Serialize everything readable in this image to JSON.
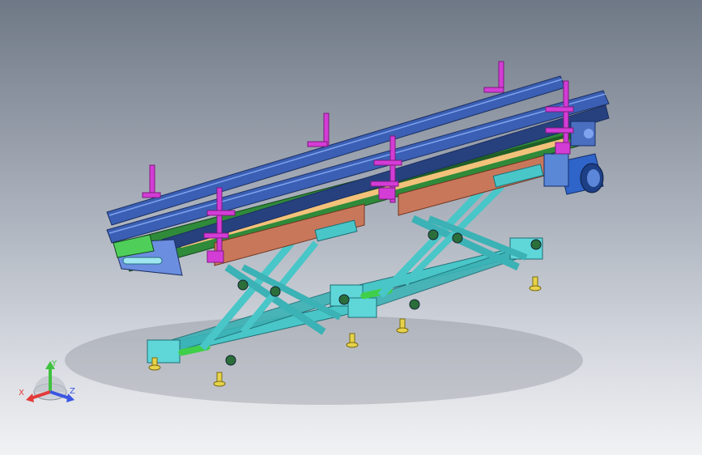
{
  "viewport": {
    "background_top": "#6f7886",
    "background_bottom": "#f1f2f4"
  },
  "model": {
    "colors": {
      "rail_blue": "#3a5fb4",
      "rail_dark": "#27417f",
      "belt_green": "#2f8a3a",
      "belt_orange": "#f3c27a",
      "side_brown": "#c9775a",
      "frame_cyan": "#49c6c8",
      "frame_dark": "#2a8f96",
      "guide_magenta": "#d43cd6",
      "motor_blue": "#2f64c8",
      "foot_yellow": "#e7d34a"
    }
  },
  "triad": {
    "x_label": "X",
    "y_label": "Y",
    "z_label": "Z",
    "x_color": "#e33a3a",
    "y_color": "#3ec23e",
    "z_color": "#3a56e3"
  }
}
